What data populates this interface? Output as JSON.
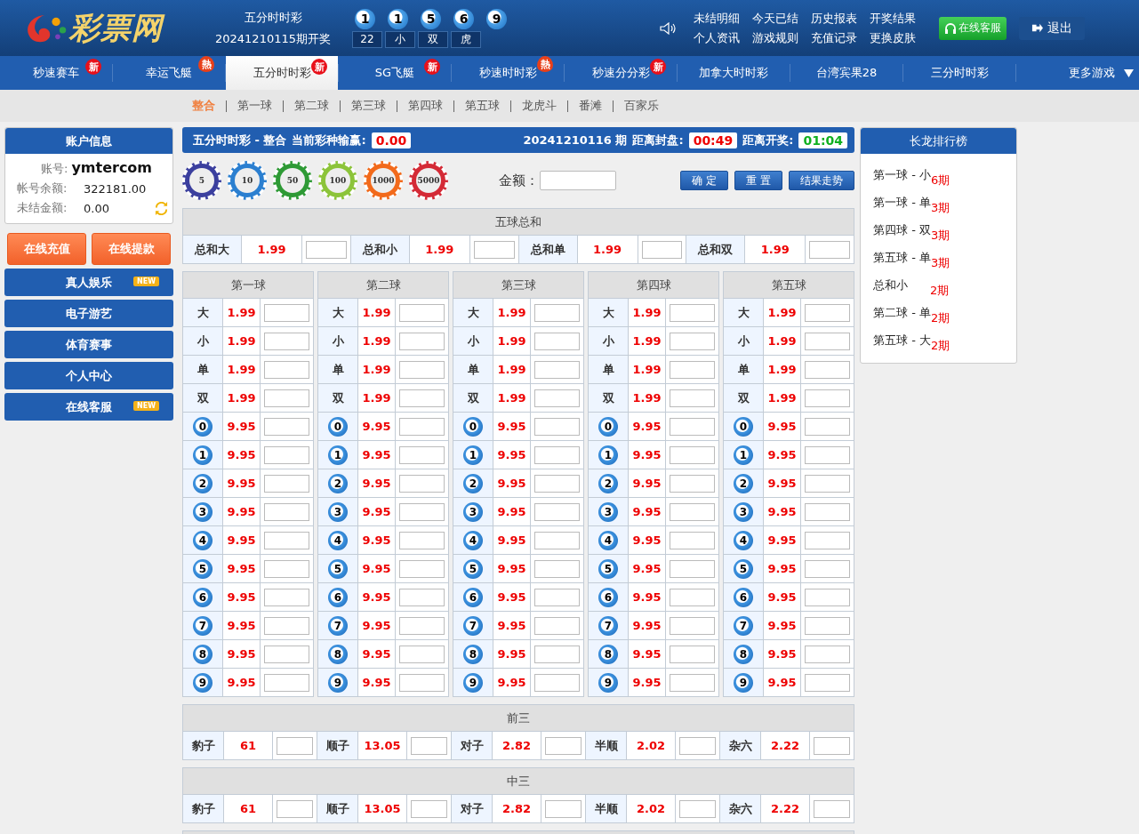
{
  "logo": "彩票网",
  "header": {
    "game": "五分时时彩",
    "draw_issue": "20241210115期开奖",
    "balls": [
      "1",
      "1",
      "5",
      "6",
      "9"
    ],
    "results": [
      "22",
      "小",
      "双",
      "虎"
    ],
    "links": [
      "未结明细",
      "今天已结",
      "历史报表",
      "开奖结果",
      "个人资讯",
      "游戏规则",
      "充值记录",
      "更换皮肤"
    ],
    "service_button": "在线客服",
    "logout_button": "退出"
  },
  "nav": [
    {
      "label": "秒速赛车",
      "badge": "新",
      "kind": "new",
      "selected": false
    },
    {
      "label": "幸运飞艇",
      "badge": "熱",
      "kind": "hot",
      "selected": false
    },
    {
      "label": "五分时时彩",
      "badge": "新",
      "kind": "new",
      "selected": true
    },
    {
      "label": "SG飞艇",
      "badge": "新",
      "kind": "new",
      "selected": false
    },
    {
      "label": "秒速时时彩",
      "badge": "熱",
      "kind": "hot",
      "selected": false
    },
    {
      "label": "秒速分分彩",
      "badge": "新",
      "kind": "new",
      "selected": false
    },
    {
      "label": "加拿大时时彩",
      "kind": "plain",
      "selected": false
    },
    {
      "label": "台湾宾果28",
      "kind": "plain",
      "selected": false
    },
    {
      "label": "三分时时彩",
      "kind": "plain",
      "selected": false
    },
    {
      "label": "更多游戏",
      "kind": "more",
      "selected": false
    }
  ],
  "subnav": [
    {
      "label": "整合",
      "selected": true
    },
    {
      "label": "第一球",
      "selected": false
    },
    {
      "label": "第二球",
      "selected": false
    },
    {
      "label": "第三球",
      "selected": false
    },
    {
      "label": "第四球",
      "selected": false
    },
    {
      "label": "第五球",
      "selected": false
    },
    {
      "label": "龙虎斗",
      "selected": false
    },
    {
      "label": "番滩",
      "selected": false
    },
    {
      "label": "百家乐",
      "selected": false
    }
  ],
  "account": {
    "title": "账户信息",
    "account_label": "账号:",
    "account": "ymtercom",
    "balance_label": "帐号余额:",
    "balance": "322181.00",
    "unsettled_label": "未结金额:",
    "unsettled": "0.00"
  },
  "sidebar_buttons": [
    "在线充值",
    "在线提款"
  ],
  "sidebar_menu": [
    {
      "label": "真人娱乐",
      "badge": "NEW"
    },
    {
      "label": "电子游艺"
    },
    {
      "label": "体育赛事"
    },
    {
      "label": "个人中心"
    },
    {
      "label": "在线客服",
      "badge": "NEW"
    }
  ],
  "bet_header": {
    "title": "五分时时彩 - 整合",
    "pl_label": "当前彩种输赢:",
    "pl": "0.00",
    "issue": "20241210116 期",
    "close_label": "距离封盘:",
    "close_time": "00:49",
    "draw_label": "距离开奖:",
    "draw_time": "01:04"
  },
  "chips": [
    {
      "value": "5",
      "color": "#3b3f9e"
    },
    {
      "value": "10",
      "color": "#2b7fd0"
    },
    {
      "value": "50",
      "color": "#2e9a35"
    },
    {
      "value": "100",
      "color": "#8cc43a"
    },
    {
      "value": "1000",
      "color": "#f26a1b"
    },
    {
      "value": "5000",
      "color": "#d42a36"
    }
  ],
  "amount_label": "金额：",
  "actions": [
    "确 定",
    "重 置",
    "结果走势"
  ],
  "sum_section": {
    "title": "五球总和",
    "items": [
      {
        "label": "总和大",
        "odds": "1.99"
      },
      {
        "label": "总和小",
        "odds": "1.99"
      },
      {
        "label": "总和单",
        "odds": "1.99"
      },
      {
        "label": "总和双",
        "odds": "1.99"
      }
    ]
  },
  "ball_columns": [
    {
      "title": "第一球",
      "rows": [
        {
          "label": "大",
          "kind": "text",
          "odds": "1.99"
        },
        {
          "label": "小",
          "kind": "text",
          "odds": "1.99"
        },
        {
          "label": "单",
          "kind": "text",
          "odds": "1.99"
        },
        {
          "label": "双",
          "kind": "text",
          "odds": "1.99"
        },
        {
          "label": "0",
          "kind": "ball",
          "odds": "9.95"
        },
        {
          "label": "1",
          "kind": "ball",
          "odds": "9.95"
        },
        {
          "label": "2",
          "kind": "ball",
          "odds": "9.95"
        },
        {
          "label": "3",
          "kind": "ball",
          "odds": "9.95"
        },
        {
          "label": "4",
          "kind": "ball",
          "odds": "9.95"
        },
        {
          "label": "5",
          "kind": "ball",
          "odds": "9.95"
        },
        {
          "label": "6",
          "kind": "ball",
          "odds": "9.95"
        },
        {
          "label": "7",
          "kind": "ball",
          "odds": "9.95"
        },
        {
          "label": "8",
          "kind": "ball",
          "odds": "9.95"
        },
        {
          "label": "9",
          "kind": "ball",
          "odds": "9.95"
        }
      ]
    },
    {
      "title": "第二球",
      "rows": [
        {
          "label": "大",
          "kind": "text",
          "odds": "1.99"
        },
        {
          "label": "小",
          "kind": "text",
          "odds": "1.99"
        },
        {
          "label": "单",
          "kind": "text",
          "odds": "1.99"
        },
        {
          "label": "双",
          "kind": "text",
          "odds": "1.99"
        },
        {
          "label": "0",
          "kind": "ball",
          "odds": "9.95"
        },
        {
          "label": "1",
          "kind": "ball",
          "odds": "9.95"
        },
        {
          "label": "2",
          "kind": "ball",
          "odds": "9.95"
        },
        {
          "label": "3",
          "kind": "ball",
          "odds": "9.95"
        },
        {
          "label": "4",
          "kind": "ball",
          "odds": "9.95"
        },
        {
          "label": "5",
          "kind": "ball",
          "odds": "9.95"
        },
        {
          "label": "6",
          "kind": "ball",
          "odds": "9.95"
        },
        {
          "label": "7",
          "kind": "ball",
          "odds": "9.95"
        },
        {
          "label": "8",
          "kind": "ball",
          "odds": "9.95"
        },
        {
          "label": "9",
          "kind": "ball",
          "odds": "9.95"
        }
      ]
    },
    {
      "title": "第三球",
      "rows": [
        {
          "label": "大",
          "kind": "text",
          "odds": "1.99"
        },
        {
          "label": "小",
          "kind": "text",
          "odds": "1.99"
        },
        {
          "label": "单",
          "kind": "text",
          "odds": "1.99"
        },
        {
          "label": "双",
          "kind": "text",
          "odds": "1.99"
        },
        {
          "label": "0",
          "kind": "ball",
          "odds": "9.95"
        },
        {
          "label": "1",
          "kind": "ball",
          "odds": "9.95"
        },
        {
          "label": "2",
          "kind": "ball",
          "odds": "9.95"
        },
        {
          "label": "3",
          "kind": "ball",
          "odds": "9.95"
        },
        {
          "label": "4",
          "kind": "ball",
          "odds": "9.95"
        },
        {
          "label": "5",
          "kind": "ball",
          "odds": "9.95"
        },
        {
          "label": "6",
          "kind": "ball",
          "odds": "9.95"
        },
        {
          "label": "7",
          "kind": "ball",
          "odds": "9.95"
        },
        {
          "label": "8",
          "kind": "ball",
          "odds": "9.95"
        },
        {
          "label": "9",
          "kind": "ball",
          "odds": "9.95"
        }
      ]
    },
    {
      "title": "第四球",
      "rows": [
        {
          "label": "大",
          "kind": "text",
          "odds": "1.99"
        },
        {
          "label": "小",
          "kind": "text",
          "odds": "1.99"
        },
        {
          "label": "单",
          "kind": "text",
          "odds": "1.99"
        },
        {
          "label": "双",
          "kind": "text",
          "odds": "1.99"
        },
        {
          "label": "0",
          "kind": "ball",
          "odds": "9.95"
        },
        {
          "label": "1",
          "kind": "ball",
          "odds": "9.95"
        },
        {
          "label": "2",
          "kind": "ball",
          "odds": "9.95"
        },
        {
          "label": "3",
          "kind": "ball",
          "odds": "9.95"
        },
        {
          "label": "4",
          "kind": "ball",
          "odds": "9.95"
        },
        {
          "label": "5",
          "kind": "ball",
          "odds": "9.95"
        },
        {
          "label": "6",
          "kind": "ball",
          "odds": "9.95"
        },
        {
          "label": "7",
          "kind": "ball",
          "odds": "9.95"
        },
        {
          "label": "8",
          "kind": "ball",
          "odds": "9.95"
        },
        {
          "label": "9",
          "kind": "ball",
          "odds": "9.95"
        }
      ]
    },
    {
      "title": "第五球",
      "rows": [
        {
          "label": "大",
          "kind": "text",
          "odds": "1.99"
        },
        {
          "label": "小",
          "kind": "text",
          "odds": "1.99"
        },
        {
          "label": "单",
          "kind": "text",
          "odds": "1.99"
        },
        {
          "label": "双",
          "kind": "text",
          "odds": "1.99"
        },
        {
          "label": "0",
          "kind": "ball",
          "odds": "9.95"
        },
        {
          "label": "1",
          "kind": "ball",
          "odds": "9.95"
        },
        {
          "label": "2",
          "kind": "ball",
          "odds": "9.95"
        },
        {
          "label": "3",
          "kind": "ball",
          "odds": "9.95"
        },
        {
          "label": "4",
          "kind": "ball",
          "odds": "9.95"
        },
        {
          "label": "5",
          "kind": "ball",
          "odds": "9.95"
        },
        {
          "label": "6",
          "kind": "ball",
          "odds": "9.95"
        },
        {
          "label": "7",
          "kind": "ball",
          "odds": "9.95"
        },
        {
          "label": "8",
          "kind": "ball",
          "odds": "9.95"
        },
        {
          "label": "9",
          "kind": "ball",
          "odds": "9.95"
        }
      ]
    }
  ],
  "combo_sections": [
    {
      "title": "前三",
      "items": [
        {
          "label": "豹子",
          "odds": "61"
        },
        {
          "label": "顺子",
          "odds": "13.05"
        },
        {
          "label": "对子",
          "odds": "2.82"
        },
        {
          "label": "半顺",
          "odds": "2.02"
        },
        {
          "label": "杂六",
          "odds": "2.22"
        }
      ]
    },
    {
      "title": "中三",
      "items": [
        {
          "label": "豹子",
          "odds": "61"
        },
        {
          "label": "顺子",
          "odds": "13.05"
        },
        {
          "label": "对子",
          "odds": "2.82"
        },
        {
          "label": "半顺",
          "odds": "2.02"
        },
        {
          "label": "杂六",
          "odds": "2.22"
        }
      ]
    }
  ],
  "ranking": {
    "title": "长龙排行榜",
    "items": [
      {
        "label": "第一球 - 小",
        "count": "6期"
      },
      {
        "label": "第一球 - 单",
        "count": "3期"
      },
      {
        "label": "第四球 - 双",
        "count": "3期"
      },
      {
        "label": "第五球 - 单",
        "count": "3期"
      },
      {
        "label": "总和小",
        "count": "2期"
      },
      {
        "label": "第二球 - 单",
        "count": "2期"
      },
      {
        "label": "第五球 - 大",
        "count": "2期"
      }
    ]
  }
}
